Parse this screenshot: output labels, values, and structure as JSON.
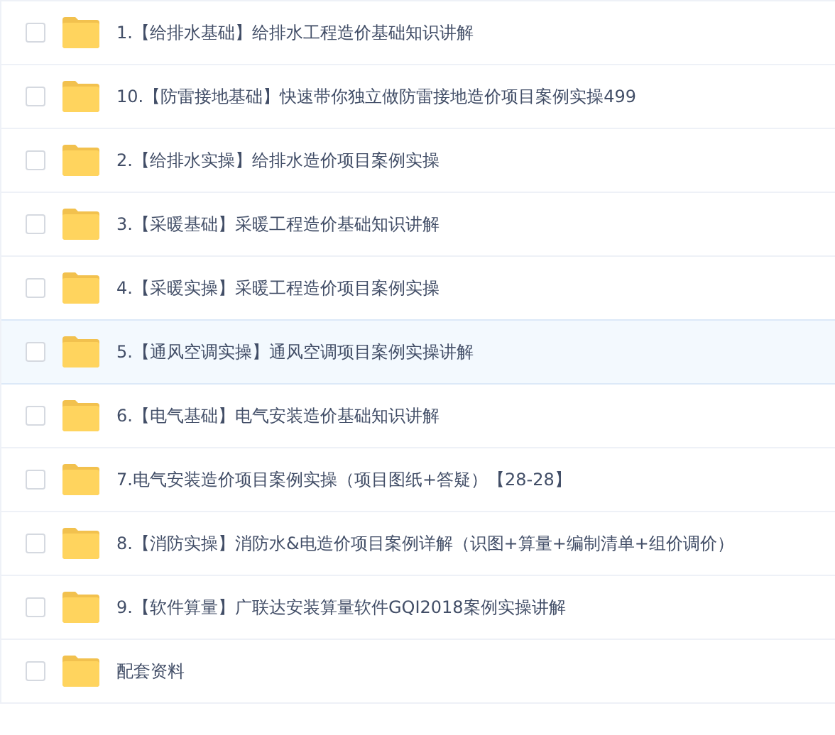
{
  "files": [
    {
      "name": "1.【给排水基础】给排水工程造价基础知识讲解",
      "checked": false,
      "selected": false
    },
    {
      "name": "10.【防雷接地基础】快速带你独立做防雷接地造价项目案例实操499",
      "checked": false,
      "selected": false
    },
    {
      "name": "2.【给排水实操】给排水造价项目案例实操",
      "checked": false,
      "selected": false
    },
    {
      "name": "3.【采暖基础】采暖工程造价基础知识讲解",
      "checked": false,
      "selected": false
    },
    {
      "name": "4.【采暖实操】采暖工程造价项目案例实操",
      "checked": false,
      "selected": false
    },
    {
      "name": "5.【通风空调实操】通风空调项目案例实操讲解",
      "checked": false,
      "selected": true
    },
    {
      "name": "6.【电气基础】电气安装造价基础知识讲解",
      "checked": false,
      "selected": false
    },
    {
      "name": "7.电气安装造价项目案例实操（项目图纸+答疑）【28-28】",
      "checked": false,
      "selected": false
    },
    {
      "name": "8.【消防实操】消防水&电造价项目案例详解（识图+算量+编制清单+组价调价）",
      "checked": false,
      "selected": false
    },
    {
      "name": "9.【软件算量】广联达安装算量软件GQI2018案例实操讲解",
      "checked": false,
      "selected": false
    },
    {
      "name": "配套资料",
      "checked": false,
      "selected": false
    }
  ]
}
